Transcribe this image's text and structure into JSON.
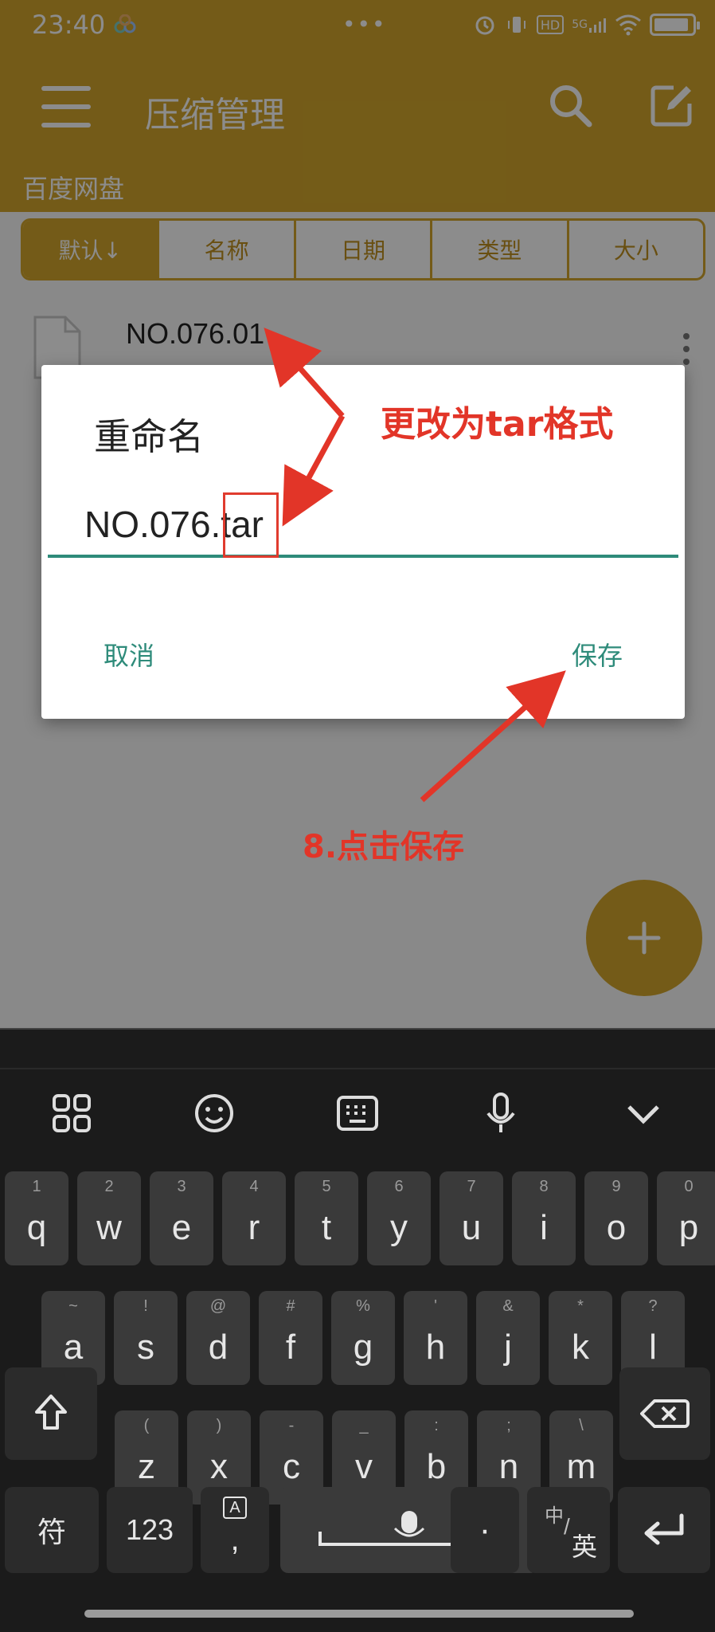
{
  "status": {
    "time": "23:40",
    "dots": "•••",
    "network_hd": "HD",
    "network_5g": "5G"
  },
  "appbar": {
    "title": "压缩管理",
    "path": "百度网盘"
  },
  "sort_tabs": [
    {
      "label": "默认↓",
      "active": true
    },
    {
      "label": "名称",
      "active": false
    },
    {
      "label": "日期",
      "active": false
    },
    {
      "label": "类型",
      "active": false
    },
    {
      "label": "大小",
      "active": false
    }
  ],
  "file": {
    "name": "NO.076.01"
  },
  "dialog": {
    "title": "重命名",
    "input_value": "NO.076.tar",
    "cancel_label": "取消",
    "save_label": "保存"
  },
  "annotations": {
    "change_format": "更改为tar格式",
    "click_save": "8.点击保存",
    "color": "#e23528"
  },
  "keyboard": {
    "toolbar_icons": [
      "grid-icon",
      "emoji-icon",
      "keyboard-icon",
      "mic-icon",
      "chevron-down-icon"
    ],
    "row1": [
      [
        "1",
        "q"
      ],
      [
        "2",
        "w"
      ],
      [
        "3",
        "e"
      ],
      [
        "4",
        "r"
      ],
      [
        "5",
        "t"
      ],
      [
        "6",
        "y"
      ],
      [
        "7",
        "u"
      ],
      [
        "8",
        "i"
      ],
      [
        "9",
        "o"
      ],
      [
        "0",
        "p"
      ]
    ],
    "row2": [
      [
        "~",
        "a"
      ],
      [
        "!",
        "s"
      ],
      [
        "@",
        "d"
      ],
      [
        "#",
        "f"
      ],
      [
        "%",
        "g"
      ],
      [
        "'",
        "h"
      ],
      [
        "&",
        "j"
      ],
      [
        "*",
        "k"
      ],
      [
        "?",
        "l"
      ]
    ],
    "row3": [
      [
        "(",
        "z"
      ],
      [
        ")",
        "x"
      ],
      [
        "-",
        "c"
      ],
      [
        "_",
        "v"
      ],
      [
        ":",
        "b"
      ],
      [
        ";",
        "n"
      ],
      [
        "\\",
        "m"
      ]
    ],
    "symbol_label": "符",
    "num_label": "123",
    "comma_hint": "A",
    "comma_label": ",",
    "period_label": "·",
    "lang_cn": "中",
    "lang_slash": "/",
    "lang_en": "英"
  },
  "colors": {
    "appbar": "#d4a72c",
    "accent": "#2e8b7a"
  }
}
